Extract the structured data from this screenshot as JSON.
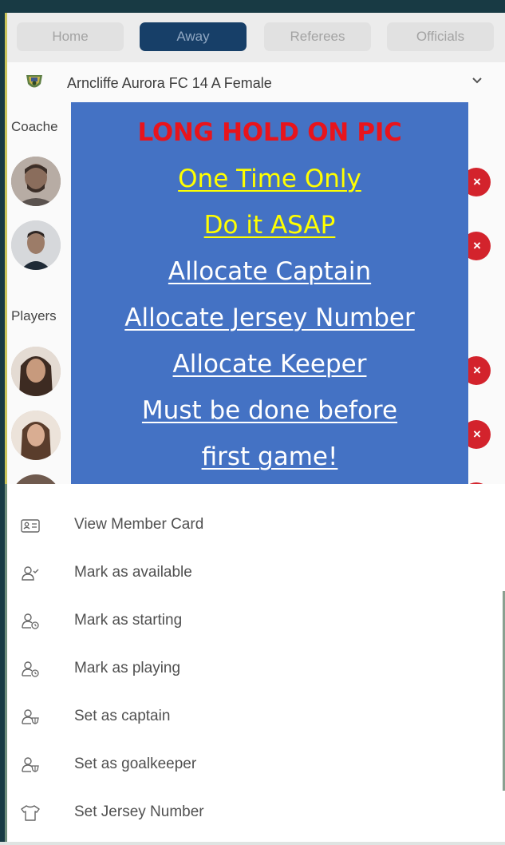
{
  "tabs": [
    {
      "label": "Home",
      "active": false
    },
    {
      "label": "Away",
      "active": true
    },
    {
      "label": "Referees",
      "active": false
    },
    {
      "label": "Officials",
      "active": false
    }
  ],
  "team": {
    "name": "Arncliffe Aurora FC 14 A Female",
    "logo_icon": "club-crest-icon",
    "expand_icon": "chevron-down-icon"
  },
  "sections": {
    "coaches": "Coache",
    "players": "Players"
  },
  "remove_icon_glyph": "×",
  "overlay": {
    "title": "LONG HOLD ON PIC",
    "lines_yellow": [
      "One Time Only",
      "Do it ASAP"
    ],
    "lines_white": [
      "Allocate Captain",
      "Allocate Jersey Number",
      "Allocate Keeper",
      "Must be done before",
      "first game!"
    ],
    "colors": {
      "background": "#4472c4",
      "title": "#e8141c",
      "highlight": "#ffff00"
    }
  },
  "menu": [
    {
      "label": "View Member Card",
      "icon": "member-card-icon"
    },
    {
      "label": "Mark as available",
      "icon": "person-check-icon"
    },
    {
      "label": "Mark as starting",
      "icon": "person-clock-icon"
    },
    {
      "label": "Mark as playing",
      "icon": "person-clock-icon"
    },
    {
      "label": "Set as captain",
      "icon": "person-shield-icon"
    },
    {
      "label": "Set as goalkeeper",
      "icon": "person-shield-icon"
    },
    {
      "label": "Set Jersey Number",
      "icon": "jersey-icon"
    }
  ],
  "colors": {
    "active_tab": "#173f68",
    "remove_button": "#d3232c",
    "frame": "#183a44"
  }
}
